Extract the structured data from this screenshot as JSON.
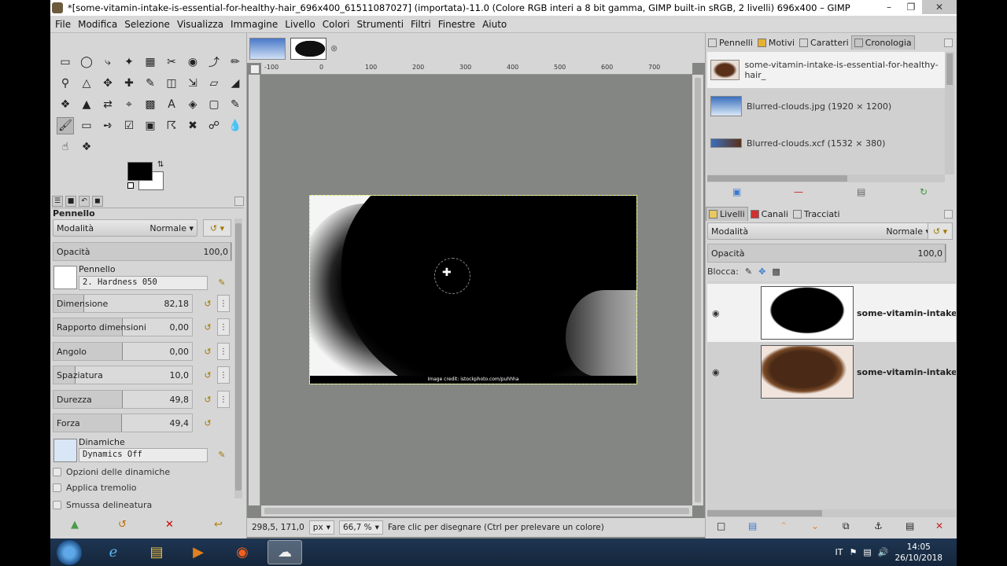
{
  "window": {
    "title": "*[some-vitamin-intake-is-essential-for-healthy-hair_696x400_61511087027] (importata)-11.0 (Colore RGB interi a 8 bit gamma, GIMP built-in sRGB, 2 livelli) 696x400 – GIMP",
    "minimize_icon": "minimize-icon",
    "maximize_icon": "restore-icon",
    "close_icon": "close-icon"
  },
  "menu": [
    "File",
    "Modifica",
    "Selezione",
    "Visualizza",
    "Immagine",
    "Livello",
    "Colori",
    "Strumenti",
    "Filtri",
    "Finestre",
    "Aiuto"
  ],
  "tool_options": {
    "panel_title": "Pennello",
    "mode_label": "Modalità",
    "mode_value": "Normale",
    "opacity_label": "Opacità",
    "opacity_value": "100,0",
    "brush_label": "Pennello",
    "brush_name": "2. Hardness 050",
    "size_label": "Dimensione",
    "size_value": "82,18",
    "aspect_label": "Rapporto dimensioni",
    "aspect_value": "0,00",
    "angle_label": "Angolo",
    "angle_value": "0,00",
    "spacing_label": "Spaziatura",
    "spacing_value": "10,0",
    "hardness_label": "Durezza",
    "hardness_value": "49,8",
    "force_label": "Forza",
    "force_value": "49,4",
    "dynamics_label": "Dinamiche",
    "dynamics_value": "Dynamics Off",
    "dyn_options": "Opzioni delle dinamiche",
    "jitter": "Applica tremolio",
    "smooth": "Smussa delineatura"
  },
  "canvas": {
    "ruler_ticks": [
      "-100",
      "0",
      "100",
      "200",
      "300",
      "400",
      "500",
      "600",
      "700"
    ],
    "image_credit": "Image credit: istockphoto.com/puhhha"
  },
  "status": {
    "coords": "298,5, 171,0",
    "unit": "px",
    "zoom": "66,7 %",
    "message": "Fare clic per disegnare (Ctrl per prelevare un colore)"
  },
  "right_top_tabs": [
    "Pennelli",
    "Motivi",
    "Caratteri",
    "Cronologia"
  ],
  "history": [
    "some-vitamin-intake-is-essential-for-healthy-hair_",
    "Blurred-clouds.jpg (1920 × 1200)",
    "Blurred-clouds.xcf (1532 × 380)"
  ],
  "right_bottom_tabs": [
    "Livelli",
    "Canali",
    "Tracciati"
  ],
  "layers_panel": {
    "mode_label": "Modalità",
    "mode_value": "Normale",
    "opacity_label": "Opacità",
    "opacity_value": "100,0",
    "lock_label": "Blocca:",
    "layers": [
      "some-vitamin-intake-i",
      "some-vitamin-intake-i"
    ]
  },
  "taskbar": {
    "lang": "IT",
    "time": "14:05",
    "date": "26/10/2018"
  }
}
